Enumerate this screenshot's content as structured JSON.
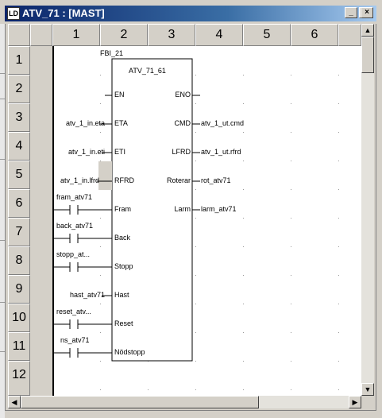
{
  "window": {
    "title": "ATV_71 : [MAST]",
    "icon_label": "LD",
    "buttons": {
      "minimize": "_",
      "maximize": "□",
      "close": "×"
    }
  },
  "grid": {
    "columns": [
      "1",
      "2",
      "3",
      "4",
      "5",
      "6"
    ],
    "rows": [
      "1",
      "2",
      "3",
      "4",
      "5",
      "6",
      "7",
      "8",
      "9",
      "10",
      "11",
      "12"
    ]
  },
  "fbi": {
    "instance": "FBI_21",
    "type": "ATV_71_61",
    "inputs": [
      "EN",
      "ETA",
      "ETI",
      "RFRD",
      "Fram",
      "Back",
      "Stopp",
      "Hast",
      "Reset",
      "Nödstopp"
    ],
    "outputs": [
      "ENO",
      "CMD",
      "LFRD",
      "Roterar",
      "Larm"
    ],
    "input_vars": {
      "eta": "atv_1_in.eta",
      "eti": "atv_1_in.eti",
      "lfrd": "atv_1_in.lfrd",
      "hast": "hast_atv71"
    },
    "contacts": {
      "fram": "fram_atv71",
      "back": "back_atv71",
      "stopp": "stopp_at...",
      "reset": "reset_atv...",
      "ns": "ns_atv71"
    },
    "output_vars": {
      "cmd": "atv_1_ut.cmd",
      "lfrd": "atv_1_ut.rfrd",
      "roterar": "rot_atv71",
      "larm": "larm_atv71"
    }
  },
  "scroll": {
    "up": "▲",
    "down": "▼",
    "left": "◀",
    "right": "▶"
  }
}
